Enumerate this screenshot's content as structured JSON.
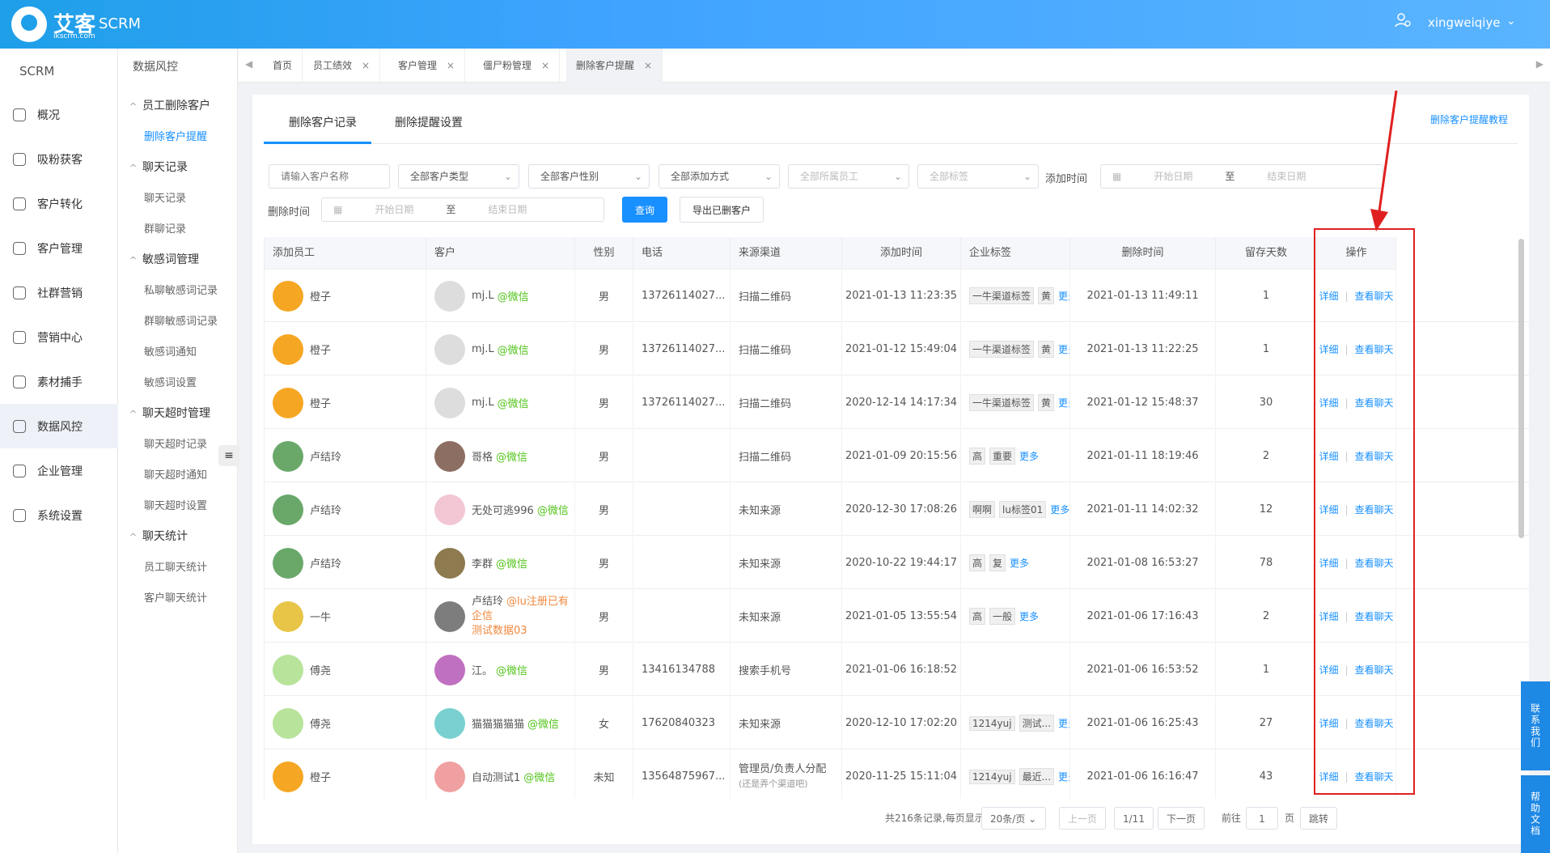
{
  "header": {
    "brand": "艾客",
    "brand_url": "ikscrm.com",
    "app": "SCRM",
    "user": "xingweiqiye"
  },
  "colors": {
    "accent": "#1890ff",
    "header": "#3fa3ff",
    "wechat": "#52c41a",
    "highlight": "#e02020"
  },
  "sidebar": {
    "title": "SCRM",
    "items": [
      {
        "label": "概况",
        "icon": "home-icon"
      },
      {
        "label": "吸粉获客",
        "icon": "user-icon"
      },
      {
        "label": "客户转化",
        "icon": "convert-icon"
      },
      {
        "label": "客户管理",
        "icon": "users-icon"
      },
      {
        "label": "社群营销",
        "icon": "group-icon"
      },
      {
        "label": "营销中心",
        "icon": "marketing-icon"
      },
      {
        "label": "素材捕手",
        "icon": "material-icon"
      },
      {
        "label": "数据风控",
        "icon": "shield-icon"
      },
      {
        "label": "企业管理",
        "icon": "company-icon"
      },
      {
        "label": "系统设置",
        "icon": "gear-icon"
      }
    ]
  },
  "subnav": {
    "title": "数据风控",
    "groups": [
      {
        "label": "员工删除客户",
        "items": [
          "删除客户提醒"
        ]
      },
      {
        "label": "聊天记录",
        "items": [
          "聊天记录",
          "群聊记录"
        ]
      },
      {
        "label": "敏感词管理",
        "items": [
          "私聊敏感词记录",
          "群聊敏感词记录",
          "敏感词通知",
          "敏感词设置"
        ]
      },
      {
        "label": "聊天超时管理",
        "items": [
          "聊天超时记录",
          "聊天超时通知",
          "聊天超时设置"
        ]
      },
      {
        "label": "聊天统计",
        "items": [
          "员工聊天统计",
          "客户聊天统计"
        ]
      }
    ]
  },
  "tabs": [
    "首页",
    "员工绩效",
    "客户管理",
    "僵尸粉管理",
    "删除客户提醒"
  ],
  "page": {
    "tabs": [
      "删除客户记录",
      "删除提醒设置"
    ],
    "tutorial": "删除客户提醒教程",
    "filters": {
      "customer_name_placeholder": "请输入客户名称",
      "type": "全部客户类型",
      "gender": "全部客户性别",
      "add_method": "全部添加方式",
      "staff": "全部所属员工",
      "tags": "全部标签",
      "add_time_label": "添加时间",
      "delete_time_label": "删除时间",
      "start": "开始日期",
      "to": "至",
      "end": "结束日期",
      "query": "查询",
      "export": "导出已删客户"
    },
    "columns": [
      "添加员工",
      "客户",
      "性别",
      "电话",
      "来源渠道",
      "添加时间",
      "企业标签",
      "删除时间",
      "留存天数",
      "操作"
    ],
    "rows": [
      {
        "staff": "橙子",
        "cust": "mj.L",
        "channel": "@微信",
        "gender": "男",
        "phone": "13726114027...",
        "source": "扫描二维码",
        "source2": "",
        "added": "2021-01-13 11:23:35",
        "tags": [
          "一牛渠道标签",
          "黄"
        ],
        "deleted": "2021-01-13 11:49:11",
        "days": "1"
      },
      {
        "staff": "橙子",
        "cust": "mj.L",
        "channel": "@微信",
        "gender": "男",
        "phone": "13726114027...",
        "source": "扫描二维码",
        "source2": "",
        "added": "2021-01-12 15:49:04",
        "tags": [
          "一牛渠道标签",
          "黄"
        ],
        "deleted": "2021-01-13 11:22:25",
        "days": "1"
      },
      {
        "staff": "橙子",
        "cust": "mj.L",
        "channel": "@微信",
        "gender": "男",
        "phone": "13726114027...",
        "source": "扫描二维码",
        "source2": "",
        "added": "2020-12-14 14:17:34",
        "tags": [
          "一牛渠道标签",
          "黄"
        ],
        "deleted": "2021-01-12 15:48:37",
        "days": "30"
      },
      {
        "staff": "卢结玲",
        "cust": "哥格",
        "channel": "@微信",
        "gender": "男",
        "phone": "",
        "source": "扫描二维码",
        "source2": "",
        "added": "2021-01-09 20:15:56",
        "tags": [
          "高",
          "重要"
        ],
        "deleted": "2021-01-11 18:19:46",
        "days": "2"
      },
      {
        "staff": "卢结玲",
        "cust": "无处可逃996",
        "channel": "@微信",
        "gender": "男",
        "phone": "",
        "source": "未知来源",
        "source2": "",
        "added": "2020-12-30 17:08:26",
        "tags": [
          "啊啊",
          "lu标签01"
        ],
        "deleted": "2021-01-11 14:02:32",
        "days": "12"
      },
      {
        "staff": "卢结玲",
        "cust": "李群",
        "channel": "@微信",
        "gender": "男",
        "phone": "",
        "source": "未知来源",
        "source2": "",
        "added": "2020-10-22 19:44:17",
        "tags": [
          "高",
          "复"
        ],
        "deleted": "2021-01-08 16:53:27",
        "days": "78"
      },
      {
        "staff": "一牛",
        "cust": "卢结玲",
        "channel": "@lu注册已有企信",
        "channel2": "测试数据03",
        "gender": "男",
        "phone": "",
        "source": "未知来源",
        "source2": "",
        "added": "2021-01-05 13:55:54",
        "tags": [
          "高",
          "一般"
        ],
        "deleted": "2021-01-06 17:16:43",
        "days": "2"
      },
      {
        "staff": "傅尧",
        "cust": "江。",
        "channel": "@微信",
        "gender": "男",
        "phone": "13416134788",
        "source": "搜索手机号",
        "source2": "",
        "added": "2021-01-06 16:18:52",
        "tags": [],
        "deleted": "2021-01-06 16:53:52",
        "days": "1"
      },
      {
        "staff": "傅尧",
        "cust": "猫猫猫猫猫",
        "channel": "@微信",
        "gender": "女",
        "phone": "17620840323",
        "source": "未知来源",
        "source2": "",
        "added": "2020-12-10 17:02:20",
        "tags": [
          "1214yuj",
          "测试..."
        ],
        "deleted": "2021-01-06 16:25:43",
        "days": "27"
      },
      {
        "staff": "橙子",
        "cust": "自动测试1",
        "channel": "@微信",
        "gender": "未知",
        "phone": "13564875967...",
        "source": "管理员/负责人分配",
        "source2": "(还是弄个渠道吧)",
        "added": "2020-11-25 15:11:04",
        "tags": [
          "1214yuj",
          "最近..."
        ],
        "deleted": "2021-01-06 16:16:47",
        "days": "43"
      }
    ],
    "more": "更多",
    "op_detail": "详细",
    "op_chat": "查看聊天",
    "pager": {
      "summary": "共216条记录,每页显示",
      "per_page": "20条/页",
      "prev": "上一页",
      "page": "1/11",
      "next": "下一页",
      "goto": "前往",
      "goto_value": "1",
      "page_unit": "页",
      "jump": "跳转"
    }
  },
  "float": {
    "contact": "联系我们",
    "docs": "帮助文档"
  }
}
